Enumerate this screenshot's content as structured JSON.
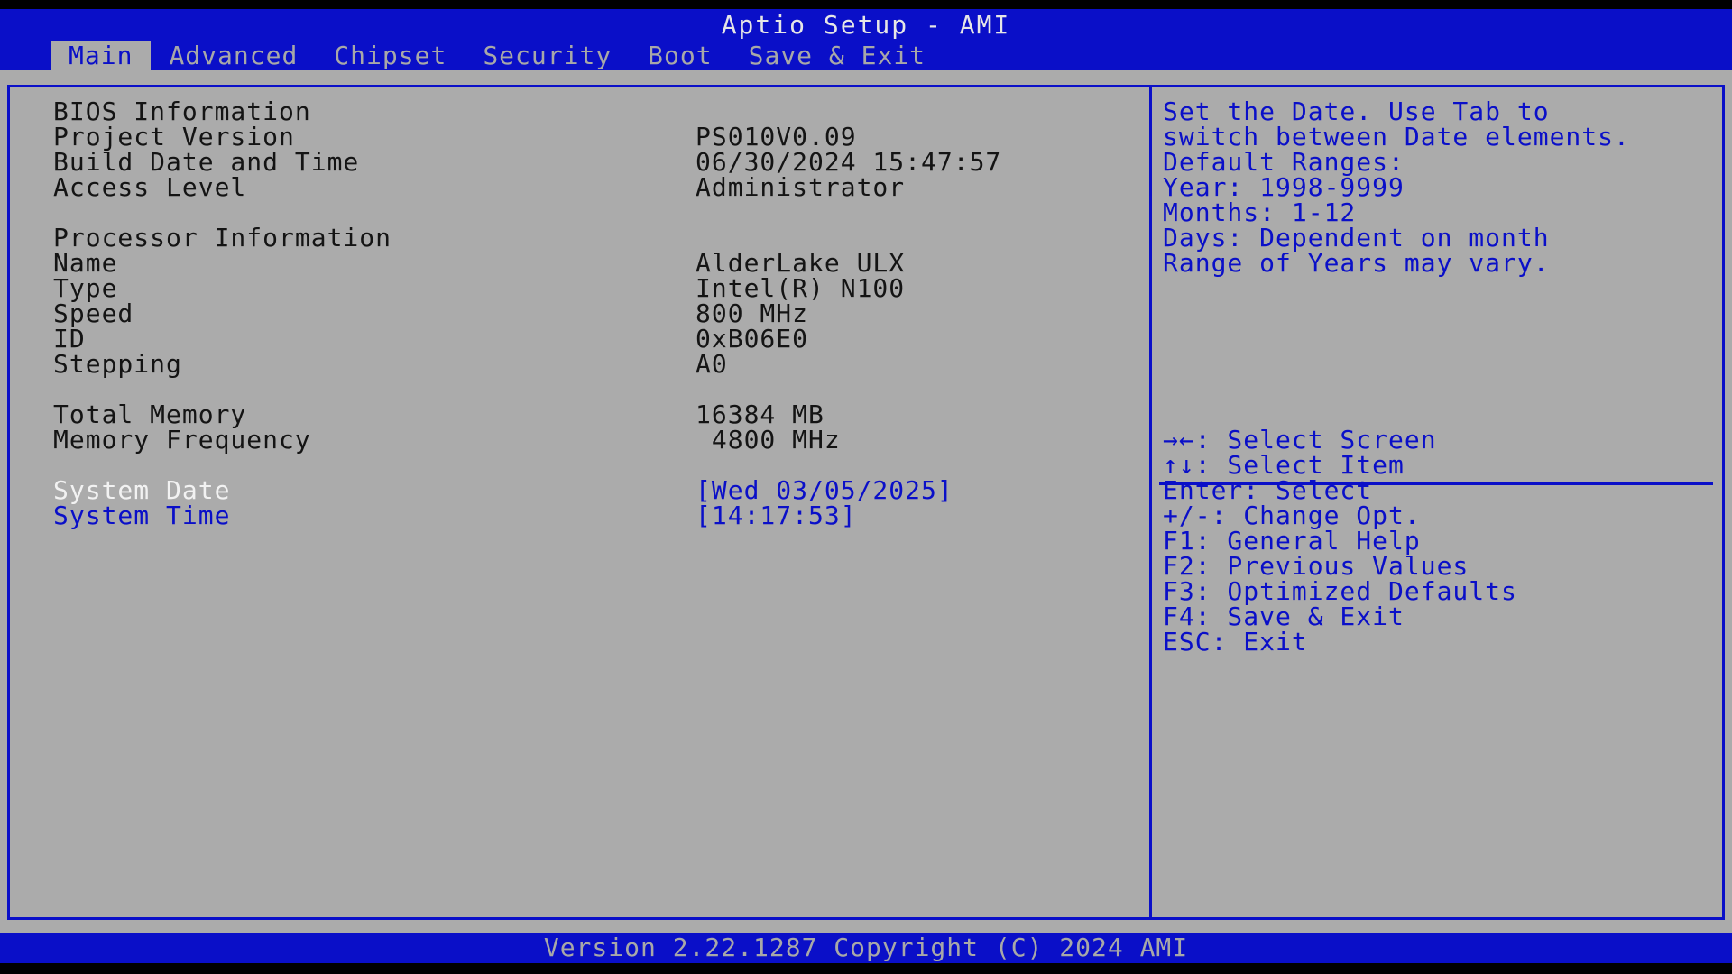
{
  "header": {
    "title": "Aptio Setup - AMI",
    "tabs": [
      {
        "label": "Main",
        "active": true
      },
      {
        "label": "Advanced",
        "active": false
      },
      {
        "label": "Chipset",
        "active": false
      },
      {
        "label": "Security",
        "active": false
      },
      {
        "label": "Boot",
        "active": false
      },
      {
        "label": "Save & Exit",
        "active": false
      }
    ]
  },
  "main": {
    "bios_heading": "BIOS Information",
    "project_version_label": "Project Version",
    "project_version_value": "PS010V0.09",
    "build_date_label": "Build Date and Time",
    "build_date_value": "06/30/2024 15:47:57",
    "access_level_label": "Access Level",
    "access_level_value": "Administrator",
    "processor_heading": "Processor Information",
    "name_label": "Name",
    "name_value": "AlderLake ULX",
    "type_label": "Type",
    "type_value": "Intel(R) N100",
    "speed_label": "Speed",
    "speed_value": "800 MHz",
    "id_label": "ID",
    "id_value": "0xB06E0",
    "stepping_label": "Stepping",
    "stepping_value": "A0",
    "total_memory_label": "Total Memory",
    "total_memory_value": "16384 MB",
    "memory_freq_label": "Memory Frequency",
    "memory_freq_value": " 4800 MHz",
    "system_date_label": "System Date",
    "system_date_value": "[Wed 03/05/2025]",
    "system_time_label": "System Time",
    "system_time_value": "[14:17:53]"
  },
  "help": {
    "description": [
      "Set the Date. Use Tab to",
      "switch between Date elements.",
      "Default Ranges:",
      "Year: 1998-9999",
      "Months: 1-12",
      "Days: Dependent on month",
      "Range of Years may vary."
    ],
    "keys": [
      "→←: Select Screen",
      "↑↓: Select Item",
      "Enter: Select",
      "+/-: Change Opt.",
      "F1: General Help",
      "F2: Previous Values",
      "F3: Optimized Defaults",
      "F4: Save & Exit",
      "ESC: Exit"
    ]
  },
  "footer": {
    "version": "Version 2.22.1287 Copyright (C) 2024 AMI"
  },
  "colors": {
    "bios_blue": "#0a0fc8",
    "panel_gray": "#ababab",
    "selected_white": "#f2f2f2"
  }
}
